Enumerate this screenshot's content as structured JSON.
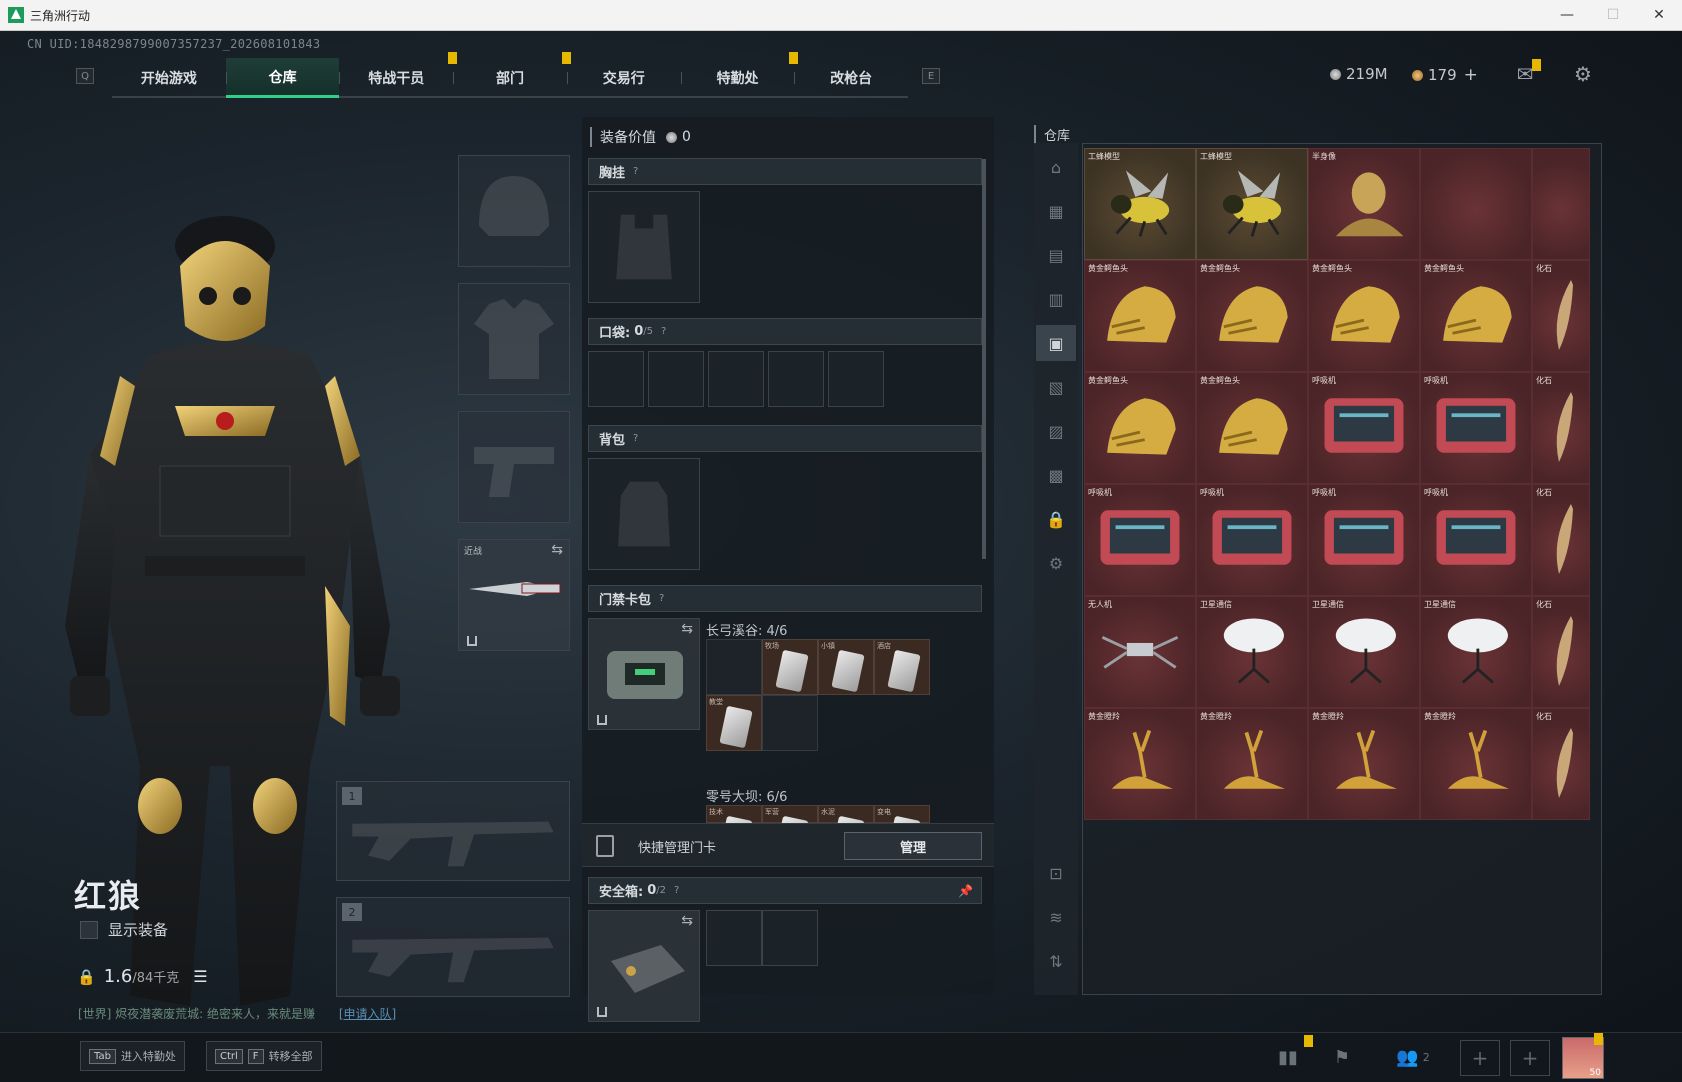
{
  "window": {
    "title": "三角洲行动",
    "controls": {
      "minimize": "—",
      "maximize": "☐",
      "close": "✕"
    }
  },
  "uid": "CN UID:1848298799007357237_202608101843",
  "nav": {
    "left_key": "Q",
    "right_key": "E",
    "tabs": [
      {
        "label": "开始游戏",
        "active": false,
        "marked": false
      },
      {
        "label": "仓库",
        "active": true,
        "marked": false
      },
      {
        "label": "特战干员",
        "active": false,
        "marked": true
      },
      {
        "label": "部门",
        "active": false,
        "marked": true
      },
      {
        "label": "交易行",
        "active": false,
        "marked": false
      },
      {
        "label": "特勤处",
        "active": false,
        "marked": true
      },
      {
        "label": "改枪台",
        "active": false,
        "marked": false
      }
    ]
  },
  "currency": {
    "hafcoin": "219M",
    "bond": "179",
    "bond_add": "+"
  },
  "colors": {
    "accent": "#2fd08a",
    "badge": "#e6b800",
    "item_red": "#4a2427"
  },
  "character": {
    "name": "红狼",
    "show_equipment_label": "显示装备",
    "weight_value": "1.6",
    "weight_max": "/84千克"
  },
  "chat": {
    "text": "[世界] 烬夜潜袭废荒城: 绝密来人，来就是赚",
    "apply": "[申请入队]"
  },
  "equipment_slots": {
    "melee_label": "近战",
    "weapon1_num": "1",
    "weapon2_num": "2"
  },
  "loadout": {
    "value_label": "装备价值",
    "value": "0",
    "chest_rig": "胸挂",
    "pockets_label": "口袋:",
    "pockets_count": "0",
    "pockets_max": "/5",
    "backpack": "背包",
    "keycard_case": "门禁卡包",
    "question": "?",
    "map1_name": "长弓溪谷: 4/6",
    "map1_cards": [
      "",
      "牧场",
      "小镇",
      "酒店",
      "教堂",
      ""
    ],
    "map2_name": "零号大坝: 6/6",
    "map2_cards": [
      "技术",
      "军营",
      "水泥",
      "变电"
    ],
    "quick_manage": "快捷管理门卡",
    "manage_btn": "管理",
    "safe_box_label": "安全箱:",
    "safe_box_count": "0",
    "safe_box_max": "/2"
  },
  "warehouse": {
    "title": "仓库",
    "rows": [
      [
        {
          "label": "工蜂模型",
          "type": "bee",
          "gold": true
        },
        {
          "label": "工蜂模型",
          "type": "bee",
          "gold": true
        },
        {
          "label": "半身像",
          "type": "bust",
          "gold": false
        },
        {
          "label": "",
          "type": "none",
          "gold": false
        },
        {
          "label": "",
          "type": "none",
          "gold": false
        }
      ],
      [
        {
          "label": "黄金鳄鱼头",
          "type": "croc",
          "gold": false
        },
        {
          "label": "黄金鳄鱼头",
          "type": "croc",
          "gold": false
        },
        {
          "label": "黄金鳄鱼头",
          "type": "croc",
          "gold": false
        },
        {
          "label": "黄金鳄鱼头",
          "type": "croc",
          "gold": false
        },
        {
          "label": "化石",
          "type": "fossil",
          "gold": false
        }
      ],
      [
        {
          "label": "黄金鳄鱼头",
          "type": "croc",
          "gold": false
        },
        {
          "label": "黄金鳄鱼头",
          "type": "croc",
          "gold": false
        },
        {
          "label": "呼吸机",
          "type": "vent",
          "gold": false
        },
        {
          "label": "呼吸机",
          "type": "vent",
          "gold": false
        },
        {
          "label": "化石",
          "type": "fossil",
          "gold": false
        }
      ],
      [
        {
          "label": "呼吸机",
          "type": "vent",
          "gold": false
        },
        {
          "label": "呼吸机",
          "type": "vent",
          "gold": false
        },
        {
          "label": "呼吸机",
          "type": "vent",
          "gold": false
        },
        {
          "label": "呼吸机",
          "type": "vent",
          "gold": false
        },
        {
          "label": "化石",
          "type": "fossil",
          "gold": false
        }
      ],
      [
        {
          "label": "无人机",
          "type": "drone",
          "gold": false
        },
        {
          "label": "卫星通信",
          "type": "dish",
          "gold": false
        },
        {
          "label": "卫星通信",
          "type": "dish",
          "gold": false
        },
        {
          "label": "卫星通信",
          "type": "dish",
          "gold": false
        },
        {
          "label": "化石",
          "type": "fossil",
          "gold": false
        }
      ],
      [
        {
          "label": "黄金瞪羚",
          "type": "gazelle",
          "gold": false
        },
        {
          "label": "黄金瞪羚",
          "type": "gazelle",
          "gold": false
        },
        {
          "label": "黄金瞪羚",
          "type": "gazelle",
          "gold": false
        },
        {
          "label": "黄金瞪羚",
          "type": "gazelle",
          "gold": false
        },
        {
          "label": "化石",
          "type": "fossil",
          "gold": false
        }
      ]
    ]
  },
  "bottom": {
    "tab_key": "Tab",
    "tab_label": "进入特勤处",
    "ctrl_key": "Ctrl",
    "f_key": "F",
    "transfer_label": "转移全部",
    "friends_count": "2",
    "avatar_level": "50"
  }
}
